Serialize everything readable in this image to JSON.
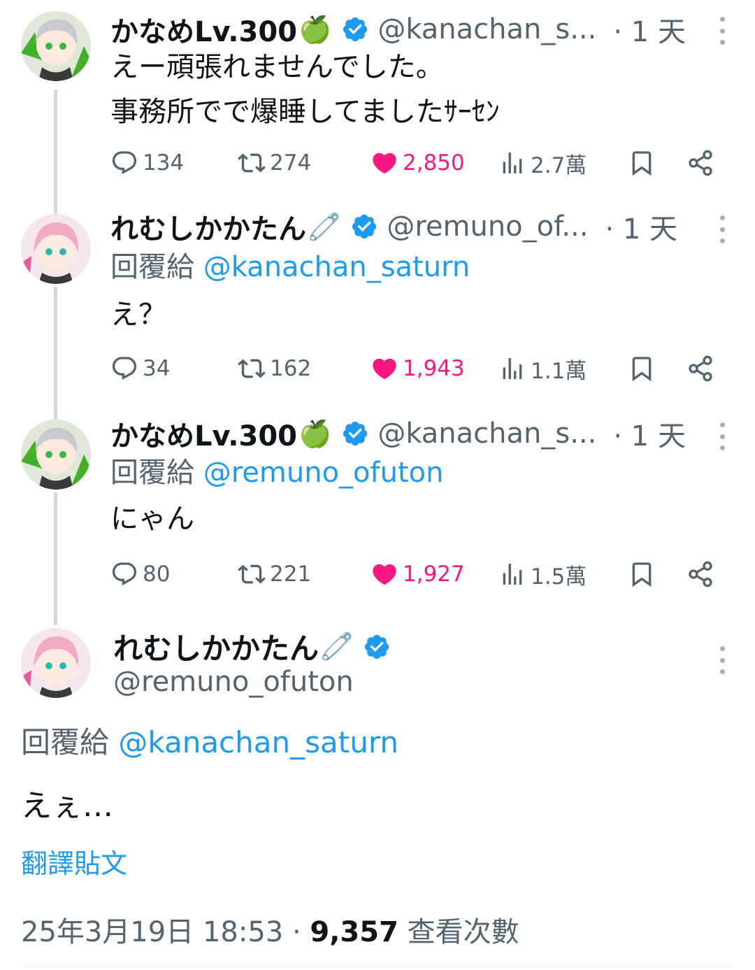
{
  "tweets": [
    {
      "name": "かなめLv.300",
      "emoji": "🍏",
      "handle": "@kanachan_s...",
      "time": "· 1 天",
      "reply_prefix": "",
      "reply_to": "",
      "lines": [
        "えー頑張れませんでした。",
        "事務所でで爆睡してましたｻｰｾﾝ"
      ],
      "replies": "134",
      "retweets": "274",
      "likes": "2,850",
      "views": "2.7萬",
      "avatar_theme": "green"
    },
    {
      "name": "れむしかかたん",
      "emoji": "🧷",
      "handle": "@remuno_of...",
      "time": "· 1 天",
      "reply_prefix": "回覆給",
      "reply_to": "@kanachan_saturn",
      "lines": [
        "え？"
      ],
      "replies": "34",
      "retweets": "162",
      "likes": "1,943",
      "views": "1.1萬",
      "avatar_theme": "pink"
    },
    {
      "name": "かなめLv.300",
      "emoji": "🍏",
      "handle": "@kanachan_s...",
      "time": "· 1 天",
      "reply_prefix": "回覆給",
      "reply_to": "@remuno_ofuton",
      "lines": [
        "にゃん"
      ],
      "replies": "80",
      "retweets": "221",
      "likes": "1,927",
      "views": "1.5萬",
      "avatar_theme": "green"
    }
  ],
  "main_tweet": {
    "name": "れむしかかたん",
    "emoji": "🧷",
    "handle": "@remuno_ofuton",
    "reply_prefix": "回覆給",
    "reply_to": "@kanachan_saturn",
    "text": "えぇ…",
    "translate_label": "翻譯貼文",
    "date": "25年3月19日 18:53",
    "separator": "·",
    "view_count": "9,357",
    "view_label": "查看次數",
    "avatar_theme": "pink"
  },
  "colors": {
    "accent": "#1d9bf0",
    "like": "#f91880",
    "muted": "#536471",
    "thread_line": "#cfd9de"
  },
  "icons": [
    "reply-icon",
    "retweet-icon",
    "like-icon",
    "views-icon",
    "bookmark-icon",
    "share-icon",
    "verified-badge-icon",
    "more-icon"
  ]
}
